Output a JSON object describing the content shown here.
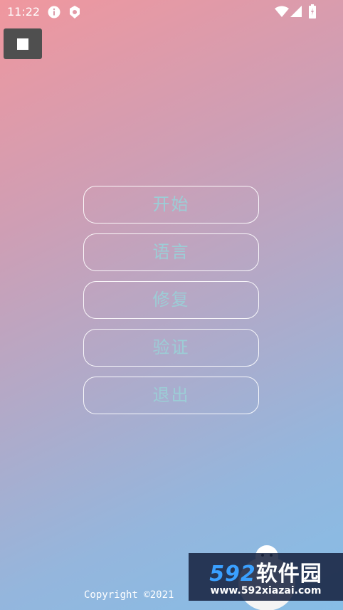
{
  "status_bar": {
    "time": "11:22",
    "icons": [
      "info-icon",
      "app-status-icon",
      "wifi-icon",
      "signal-icon",
      "battery-icon"
    ]
  },
  "toolbar": {
    "stop_icon": "stop-icon"
  },
  "menu": {
    "items": [
      {
        "label": "开始"
      },
      {
        "label": "语言"
      },
      {
        "label": "修复"
      },
      {
        "label": "验证"
      },
      {
        "label": "退出"
      }
    ]
  },
  "footer": {
    "copyright": "Copyright ©2021"
  },
  "watermark": {
    "brand_num": "592",
    "brand_text": "软件园",
    "url": "www.592xiazai.com"
  },
  "colors": {
    "gradient_top": "#f0979e",
    "gradient_bottom": "#86bde6",
    "menu_text": "#9ccdd6",
    "stop_button": "#4f4f4f"
  }
}
